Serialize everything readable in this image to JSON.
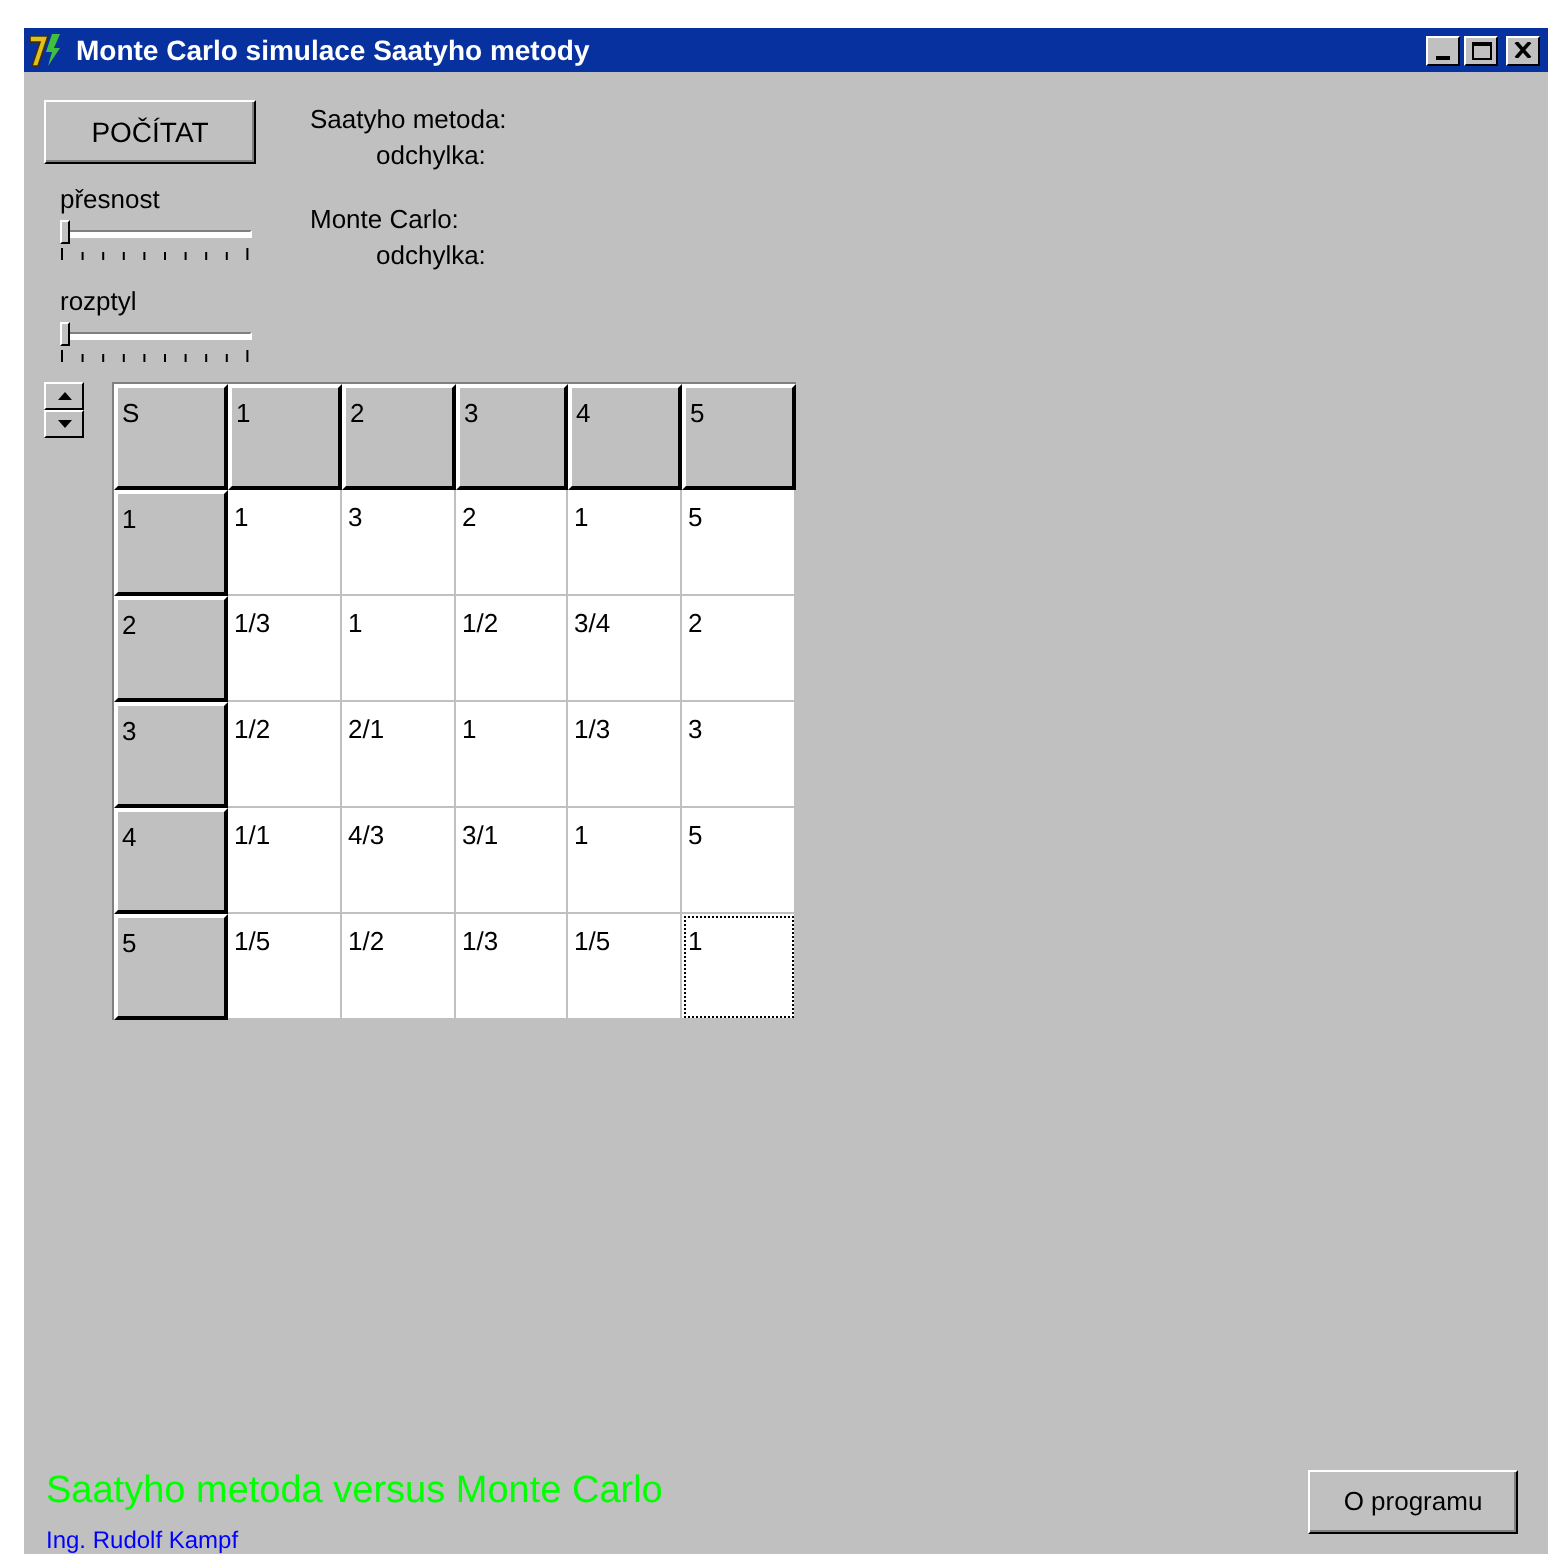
{
  "window": {
    "title": "Monte Carlo simulace Saatyho metody"
  },
  "compute_button": {
    "label": "POČÍTAT"
  },
  "sliders": [
    {
      "label": "přesnost",
      "level": 0
    },
    {
      "label": "rozptyl",
      "level": 0
    }
  ],
  "results": [
    {
      "label": "Saatyho metoda:",
      "kind": "heading"
    },
    {
      "label": "odchylka:",
      "kind": "sub"
    },
    {
      "label": "Monte Carlo:",
      "kind": "heading"
    },
    {
      "label": "odchylka:",
      "kind": "sub"
    }
  ],
  "table": {
    "columns": [
      "S",
      "1",
      "2",
      "3",
      "4",
      "5"
    ],
    "rows": [
      {
        "cells": [
          {
            "text": "1",
            "kind": "header",
            "selected": false
          },
          {
            "text": "1",
            "kind": "value",
            "selected": false
          },
          {
            "text": "3",
            "kind": "value",
            "selected": false
          },
          {
            "text": "2",
            "kind": "value",
            "selected": false
          },
          {
            "text": "1",
            "kind": "value",
            "selected": false
          },
          {
            "text": "5",
            "kind": "value",
            "selected": false
          }
        ]
      },
      {
        "cells": [
          {
            "text": "2",
            "kind": "header",
            "selected": false
          },
          {
            "text": "1/3",
            "kind": "value",
            "selected": false
          },
          {
            "text": "1",
            "kind": "value",
            "selected": false
          },
          {
            "text": "1/2",
            "kind": "value",
            "selected": false
          },
          {
            "text": "3/4",
            "kind": "value",
            "selected": false
          },
          {
            "text": "2",
            "kind": "value",
            "selected": false
          }
        ]
      },
      {
        "cells": [
          {
            "text": "3",
            "kind": "header",
            "selected": false
          },
          {
            "text": "1/2",
            "kind": "value",
            "selected": false
          },
          {
            "text": "2/1",
            "kind": "value",
            "selected": false
          },
          {
            "text": "1",
            "kind": "value",
            "selected": false
          },
          {
            "text": "1/3",
            "kind": "value",
            "selected": false
          },
          {
            "text": "3",
            "kind": "value",
            "selected": false
          }
        ]
      },
      {
        "cells": [
          {
            "text": "4",
            "kind": "header",
            "selected": false
          },
          {
            "text": "1/1",
            "kind": "value",
            "selected": false
          },
          {
            "text": "4/3",
            "kind": "value",
            "selected": false
          },
          {
            "text": "3/1",
            "kind": "value",
            "selected": false
          },
          {
            "text": "1",
            "kind": "value",
            "selected": false
          },
          {
            "text": "5",
            "kind": "value",
            "selected": false
          }
        ]
      },
      {
        "cells": [
          {
            "text": "5",
            "kind": "header",
            "selected": false
          },
          {
            "text": "1/5",
            "kind": "value",
            "selected": false
          },
          {
            "text": "1/2",
            "kind": "value",
            "selected": false
          },
          {
            "text": "1/3",
            "kind": "value",
            "selected": false
          },
          {
            "text": "1/5",
            "kind": "value",
            "selected": false
          },
          {
            "text": "1",
            "kind": "value",
            "selected": true
          }
        ]
      }
    ]
  },
  "footer": {
    "headline": "Saatyho metoda versus Monte Carlo",
    "author": "Ing. Rudolf Kampf",
    "about_button": "O programu"
  }
}
